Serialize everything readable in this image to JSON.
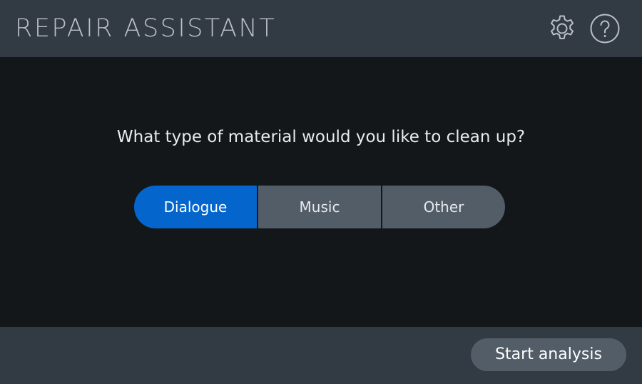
{
  "header": {
    "title": "REPAIR ASSISTANT",
    "settings_icon": "gear-icon",
    "help_icon": "question-mark-icon"
  },
  "main": {
    "question": "What type of material would you like to clean up?",
    "options": [
      {
        "label": "Dialogue",
        "selected": true
      },
      {
        "label": "Music",
        "selected": false
      },
      {
        "label": "Other",
        "selected": false
      }
    ]
  },
  "footer": {
    "start_label": "Start analysis"
  },
  "colors": {
    "accent": "#0466cc",
    "header_bg": "#323a43",
    "body_bg": "#13171a",
    "button_bg": "#525d68"
  }
}
